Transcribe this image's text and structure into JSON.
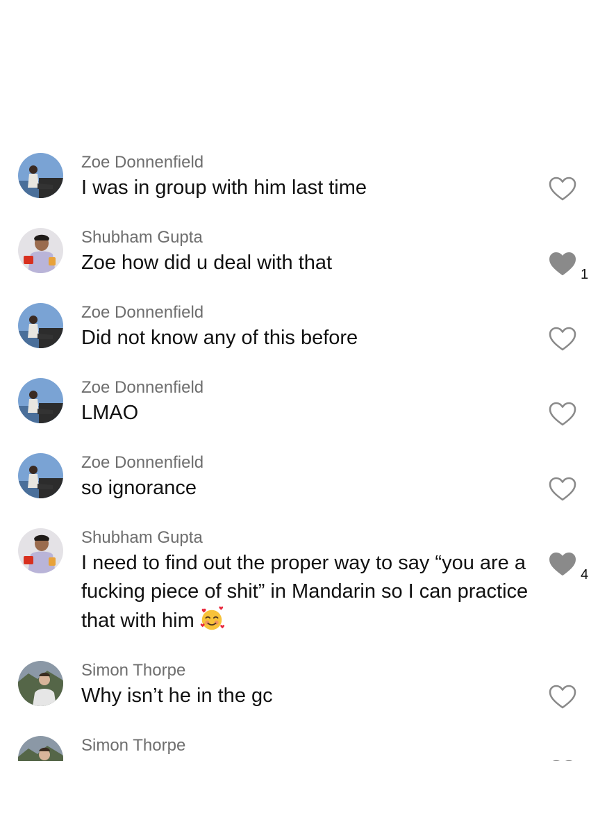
{
  "comments": [
    {
      "username": "Zoe Donnenfield",
      "text": "I was in group with him last time",
      "liked": false,
      "likes": ""
    },
    {
      "username": "Shubham Gupta",
      "text": "Zoe how did u deal with that",
      "liked": true,
      "likes": "1"
    },
    {
      "username": "Zoe Donnenfield",
      "text": "Did not know any of this before",
      "liked": false,
      "likes": ""
    },
    {
      "username": "Zoe Donnenfield",
      "text": "LMAO",
      "liked": false,
      "likes": ""
    },
    {
      "username": "Zoe Donnenfield",
      "text": "so ignorance",
      "liked": false,
      "likes": ""
    },
    {
      "username": "Shubham Gupta",
      "text": "I need to find out the proper way to say “you are a fucking piece of shit” in Mandarin so I can practice that with him",
      "emoji": "smiling-face-with-hearts",
      "liked": true,
      "likes": "4"
    },
    {
      "username": "Simon Thorpe",
      "text": "Why isn’t he in the gc",
      "liked": false,
      "likes": ""
    },
    {
      "username": "Simon Thorpe",
      "text": "",
      "liked": false,
      "likes": ""
    }
  ],
  "colors": {
    "username": "#6e6e6e",
    "text": "#111111",
    "heart_filled": "#8a8a8a",
    "heart_outline": "#8a8a8a"
  }
}
